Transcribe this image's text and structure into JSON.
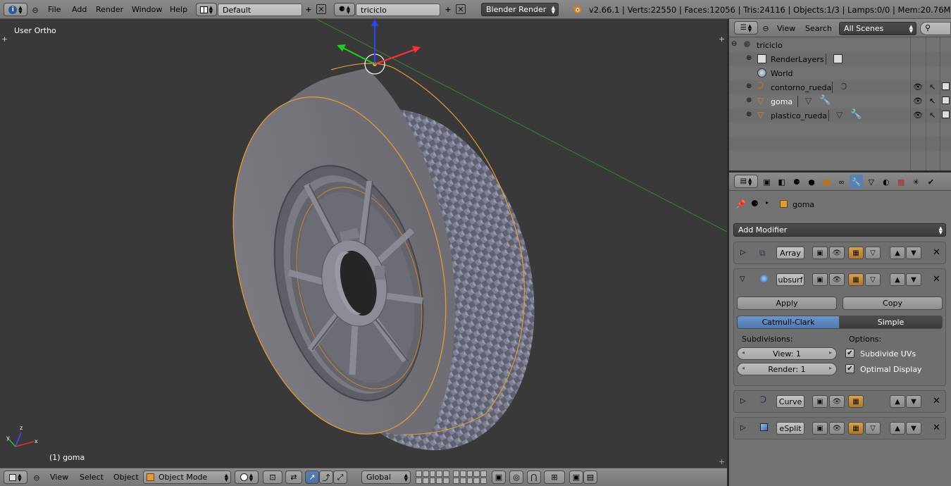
{
  "top_bar": {
    "menus": [
      "File",
      "Add",
      "Render",
      "Window",
      "Help"
    ],
    "layout_name": "Default",
    "scene_name": "triciclo",
    "render_engine": "Blender Render",
    "status": "v2.66.1 | Verts:22550 | Faces:12056 | Tris:24116 | Objects:1/3 | Lamps:0/0 | Mem:20.76M (0.11M) |"
  },
  "viewport": {
    "view_label": "User Ortho",
    "object_label": "(1) goma",
    "axis_labels": {
      "x": "x",
      "y": "y",
      "z": "z"
    },
    "colors": {
      "background": "#393939",
      "selection": "#f0a030",
      "x_axis": "#e03030",
      "y_axis": "#30c030",
      "z_axis": "#2040ff"
    }
  },
  "bottom_bar": {
    "menus": [
      "View",
      "Select",
      "Object"
    ],
    "mode": "Object Mode",
    "orientation": "Global"
  },
  "outliner": {
    "menus": [
      "View",
      "Search"
    ],
    "display_mode": "All Scenes",
    "items": [
      {
        "label": "triciclo",
        "icon": "scene-icon"
      },
      {
        "label": "RenderLayers",
        "icon": "render-layers-icon"
      },
      {
        "label": "World",
        "icon": "world-icon"
      },
      {
        "label": "contorno_rueda",
        "icon": "curve-icon"
      },
      {
        "label": "goma",
        "icon": "mesh-icon"
      },
      {
        "label": "plastico_rueda",
        "icon": "mesh-icon"
      }
    ]
  },
  "properties": {
    "object_name": "goma",
    "add_modifier": "Add Modifier",
    "modifiers": [
      {
        "name": "Array",
        "expanded": false
      },
      {
        "name": "ubsurf",
        "expanded": true
      },
      {
        "name": "Curve",
        "expanded": false
      },
      {
        "name": "eSplit",
        "expanded": false
      }
    ],
    "subsurf": {
      "apply_label": "Apply",
      "copy_label": "Copy",
      "method_active": "Catmull-Clark",
      "method_other": "Simple",
      "subdivisions_label": "Subdivisions:",
      "options_label": "Options:",
      "view_value": "View: 1",
      "render_value": "Render: 1",
      "subdivide_uvs_label": "Subdivide UVs",
      "subdivide_uvs": true,
      "optimal_display_label": "Optimal Display",
      "optimal_display": true
    }
  }
}
